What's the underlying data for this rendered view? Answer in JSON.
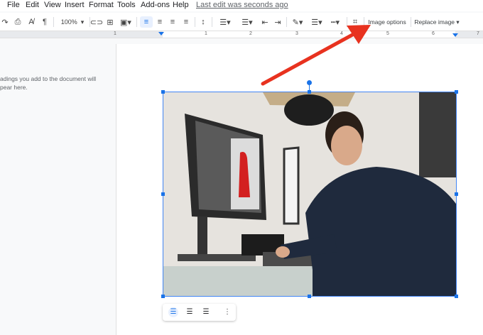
{
  "menu": {
    "items": [
      "File",
      "Edit",
      "View",
      "Insert",
      "Format",
      "Tools",
      "Add-ons",
      "Help"
    ],
    "last_edit": "Last edit was seconds ago"
  },
  "toolbar": {
    "zoom": "100%",
    "image_options": "Image options",
    "replace_image": "Replace image ▾"
  },
  "ruler": {
    "labels": [
      "1",
      "1",
      "2",
      "3",
      "4",
      "5",
      "6",
      "7"
    ]
  },
  "sidebar": {
    "empty_text_1": "adings you add to the document will",
    "empty_text_2": "pear here."
  },
  "colors": {
    "accent": "#1a73e8",
    "arrow": "#e8321f"
  }
}
